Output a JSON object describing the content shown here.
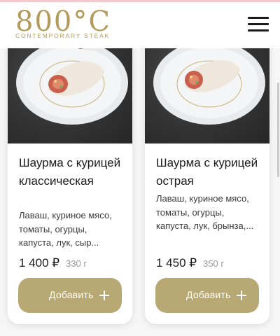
{
  "brand": {
    "digits": "800°C",
    "tagline": "CONTEMPORARY STEAK",
    "color": "#b39a5a"
  },
  "header": {
    "menu_icon": "hamburger-menu-icon"
  },
  "colors": {
    "accent": "#b8a873",
    "background": "#f6f6f6"
  },
  "products": [
    {
      "image": "shawarma-plate-photo",
      "title": "Шаурма с курицей классическая",
      "description": "Лаваш, куриное мясо, томаты, огурцы, капуста, лук, сыр...",
      "price": "1 400 ₽",
      "weight": "330 г",
      "add_label": "Добавить",
      "add_icon": "plus-icon"
    },
    {
      "image": "shawarma-plate-photo",
      "title": "Шаурма с курицей острая",
      "description": "Лаваш, куриное мясо, томаты, огурцы, капуста, лук, брынза,...",
      "price": "1 450 ₽",
      "weight": "350 г",
      "add_label": "Добавить",
      "add_icon": "plus-icon"
    }
  ]
}
